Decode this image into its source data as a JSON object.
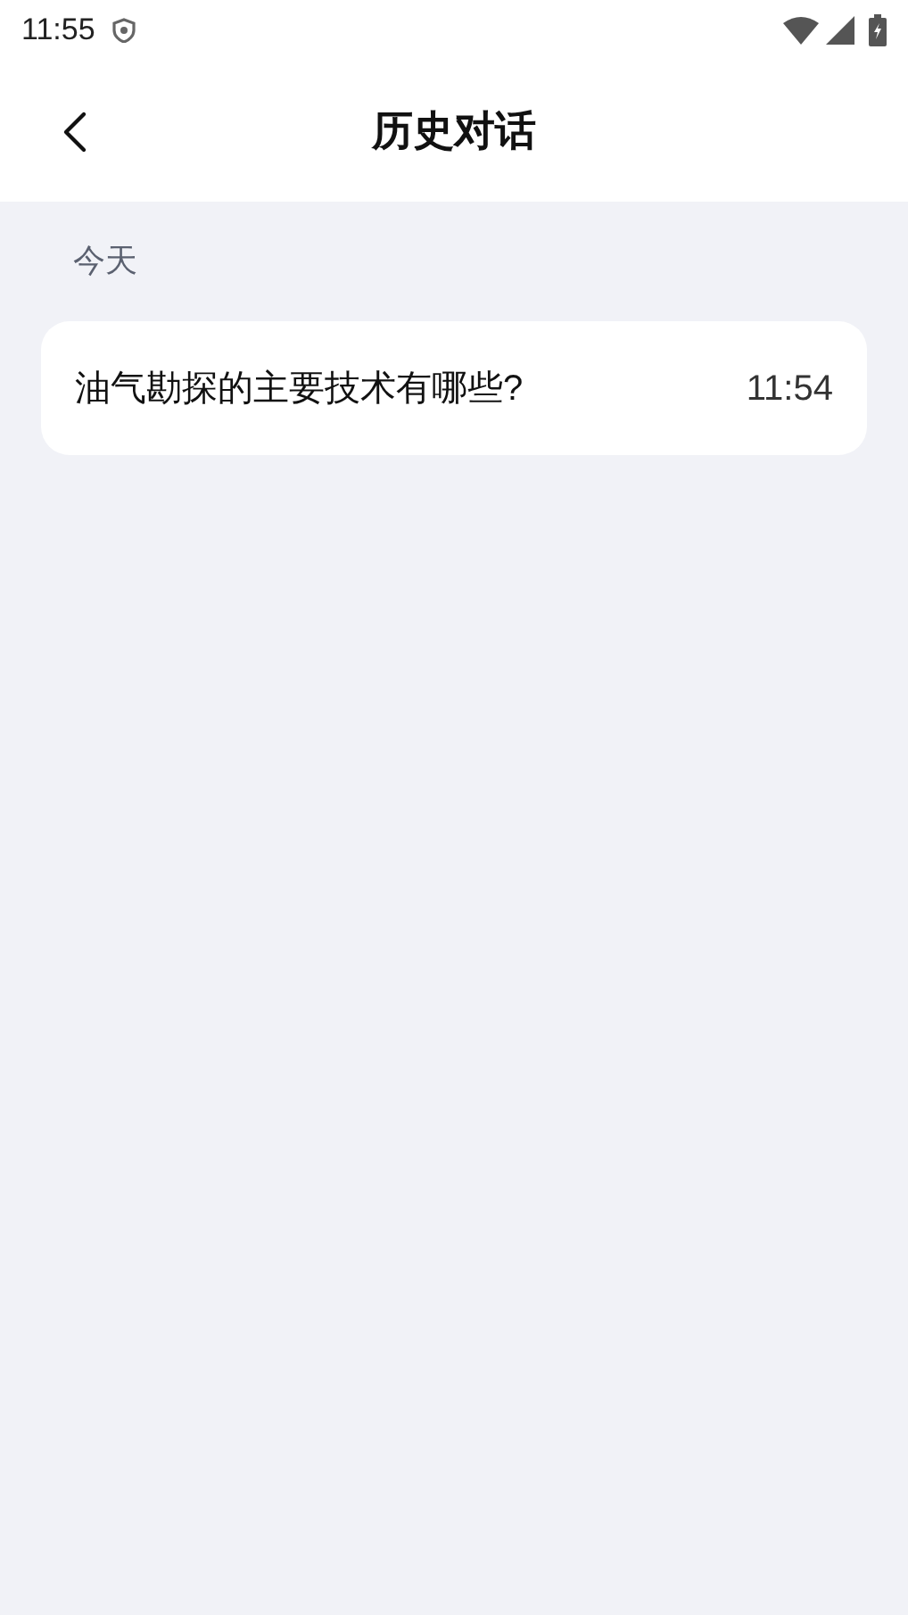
{
  "status_bar": {
    "time": "11:55"
  },
  "header": {
    "title": "历史对话"
  },
  "sections": [
    {
      "label": "今天",
      "items": [
        {
          "title": "油气勘探的主要技术有哪些?",
          "time": "11:54"
        }
      ]
    }
  ]
}
